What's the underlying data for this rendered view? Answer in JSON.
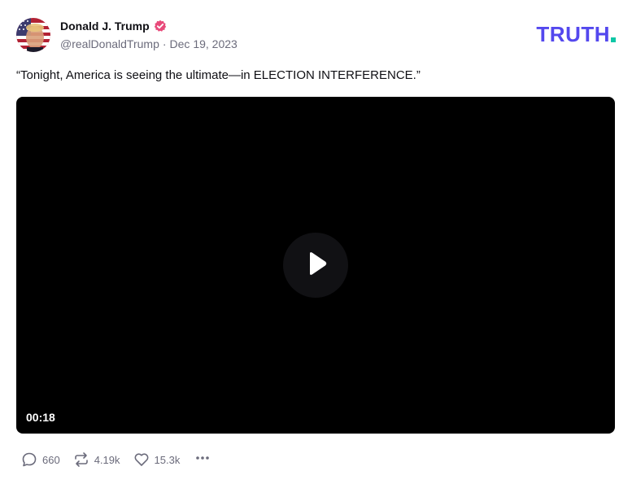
{
  "author": {
    "display_name": "Donald J. Trump",
    "handle": "@realDonaldTrump",
    "separator": "·",
    "date": "Dec 19, 2023",
    "verified": true,
    "verified_color": "#e84a7a"
  },
  "brand": {
    "logo_text": "TRUTH",
    "logo_color": "#5448ee",
    "logo_dot_color": "#0dc7a6"
  },
  "post": {
    "text": "“Tonight, America is seeing the ultimate—in ELECTION INTERFERENCE.”"
  },
  "video": {
    "duration": "00:18",
    "play_icon": "play-icon"
  },
  "actions": {
    "replies": "660",
    "retruths": "4.19k",
    "likes": "15.3k",
    "icons": [
      "reply-icon",
      "retruth-icon",
      "like-icon",
      "more-icon"
    ]
  }
}
